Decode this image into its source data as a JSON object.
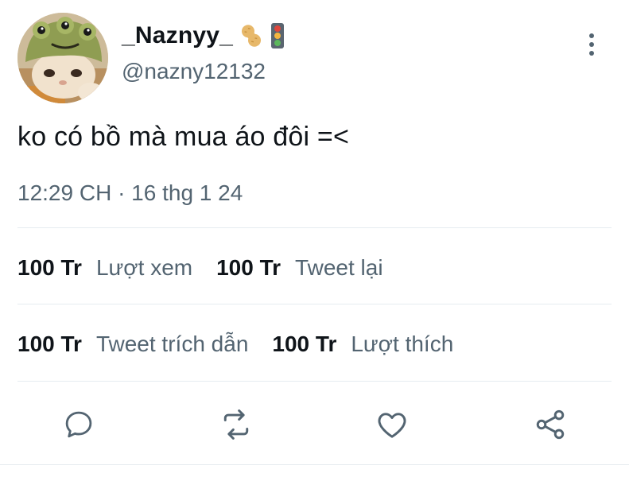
{
  "author": {
    "display_name": "_Naznyy_",
    "emojis": [
      "peanut-emoji",
      "traffic-light-emoji"
    ],
    "handle": "@nazny12132",
    "avatar": "cat-in-frog-hat-avatar"
  },
  "tweet": {
    "text": "ko có bồ mà mua áo đôi =<",
    "timestamp": "12:29 CH · 16 thg 1 24"
  },
  "stats": {
    "row1": [
      {
        "value": "100 Tr",
        "label": "Lượt xem"
      },
      {
        "value": "100 Tr",
        "label": "Tweet lại"
      }
    ],
    "row2": [
      {
        "value": "100 Tr",
        "label": "Tweet trích dẫn"
      },
      {
        "value": "100 Tr",
        "label": "Lượt thích"
      }
    ]
  },
  "actions": [
    {
      "icon": "reply-icon"
    },
    {
      "icon": "retweet-icon"
    },
    {
      "icon": "like-icon"
    },
    {
      "icon": "share-icon"
    }
  ],
  "colors": {
    "text_primary": "#0f1419",
    "text_secondary": "#536471",
    "divider": "#e6ecf0",
    "icon": "#536471"
  }
}
